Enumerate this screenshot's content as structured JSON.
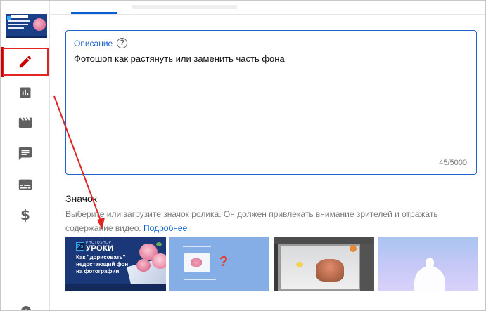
{
  "sidebar": {
    "items": [
      {
        "name": "details-icon",
        "active": true
      },
      {
        "name": "analytics-icon",
        "active": false
      },
      {
        "name": "editor-icon",
        "active": false
      },
      {
        "name": "comments-icon",
        "active": false
      },
      {
        "name": "subtitles-icon",
        "active": false
      },
      {
        "name": "monetization-icon",
        "active": false
      }
    ],
    "monetization_symbol": "$",
    "active_color": "#cc0000",
    "highlight_color": "#e02424"
  },
  "description": {
    "label": "Описание",
    "help_symbol": "?",
    "value": "Фотошоп как растянуть или заменить часть фона",
    "counter": "45/5000",
    "accent": "#1f62c9"
  },
  "thumbnail": {
    "title": "Значок",
    "hint": "Выберите или загрузите значок ролика. Он должен привлекать внимание зрителей и отражать содержание видео.",
    "more_link": "Подробнее",
    "options": [
      {
        "id": "thumb-1",
        "ps": "Ps",
        "brand_small": "PHOTOSHOP",
        "brand": "УРОКИ",
        "lines": [
          "Как \"дорисовать\"",
          "недостающий фон",
          "на фотографии"
        ]
      },
      {
        "id": "thumb-2"
      },
      {
        "id": "thumb-3"
      },
      {
        "id": "thumb-4"
      }
    ]
  },
  "tab": {
    "active_color": "#065fd4"
  }
}
